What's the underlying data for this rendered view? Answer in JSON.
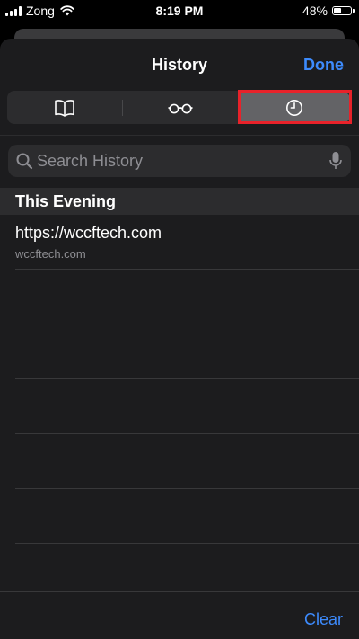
{
  "status_bar": {
    "carrier": "Zong",
    "time": "8:19 PM",
    "battery": "48%",
    "battery_level": 0.48
  },
  "nav": {
    "title": "History",
    "done_label": "Done"
  },
  "segments": [
    {
      "icon": "book-icon",
      "selected": false
    },
    {
      "icon": "glasses-icon",
      "selected": false
    },
    {
      "icon": "clock-icon",
      "selected": true
    }
  ],
  "search": {
    "placeholder": "Search History",
    "value": ""
  },
  "section": {
    "header": "This Evening"
  },
  "history": [
    {
      "title": "https://wccftech.com",
      "subtitle": "wccftech.com"
    }
  ],
  "footer": {
    "clear_label": "Clear"
  },
  "colors": {
    "accent": "#3d8bfd",
    "highlight": "#e8222a",
    "sheet_bg": "#1c1c1e"
  }
}
